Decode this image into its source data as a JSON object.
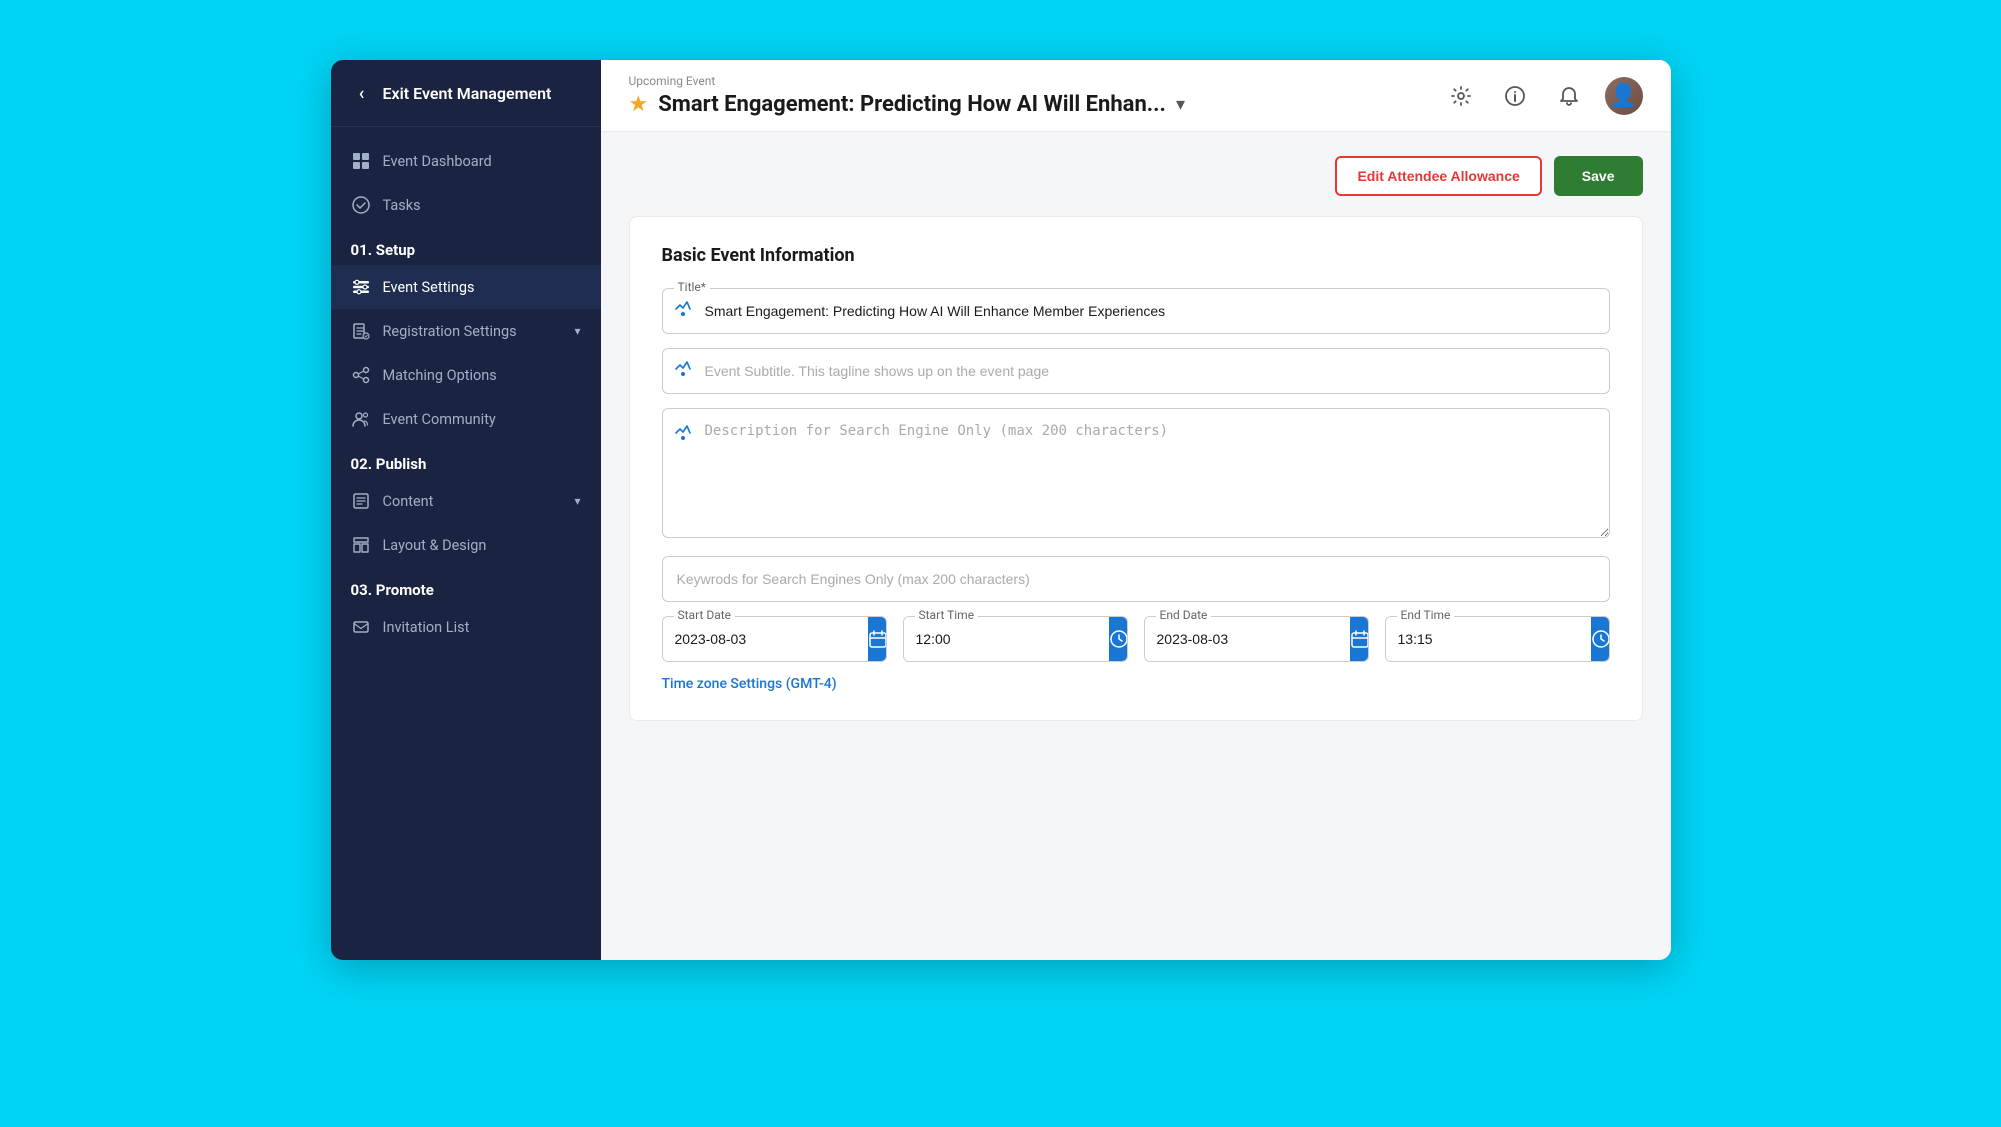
{
  "app": {
    "bg_color": "#00d4f5"
  },
  "sidebar": {
    "exit_label": "Exit Event Management",
    "back_arrow": "‹",
    "sections": [
      {
        "type": "item",
        "icon": "grid",
        "label": "Event Dashboard",
        "active": false,
        "name": "event-dashboard"
      },
      {
        "type": "item",
        "icon": "check-circle",
        "label": "Tasks",
        "active": false,
        "name": "tasks"
      },
      {
        "type": "header",
        "label": "01. Setup"
      },
      {
        "type": "item",
        "icon": "settings",
        "label": "Event Settings",
        "active": true,
        "name": "event-settings"
      },
      {
        "type": "item",
        "icon": "register",
        "label": "Registration Settings",
        "active": false,
        "name": "registration-settings",
        "has_chevron": true
      },
      {
        "type": "item",
        "icon": "share",
        "label": "Matching Options",
        "active": false,
        "name": "matching-options"
      },
      {
        "type": "item",
        "icon": "people",
        "label": "Event Community",
        "active": false,
        "name": "event-community"
      },
      {
        "type": "header",
        "label": "02. Publish"
      },
      {
        "type": "item",
        "icon": "content",
        "label": "Content",
        "active": false,
        "name": "content",
        "has_chevron": true
      },
      {
        "type": "item",
        "icon": "layout",
        "label": "Layout & Design",
        "active": false,
        "name": "layout-design"
      },
      {
        "type": "header",
        "label": "03. Promote"
      },
      {
        "type": "item",
        "icon": "invite",
        "label": "Invitation List",
        "active": false,
        "name": "invitation-list"
      }
    ]
  },
  "header": {
    "upcoming_label": "Upcoming Event",
    "event_title": "Smart Engagement: Predicting How AI Will Enhan...",
    "dropdown_char": "▾",
    "star": "★"
  },
  "toolbar": {
    "edit_allowance_label": "Edit Attendee Allowance",
    "save_label": "Save"
  },
  "form": {
    "section_title": "Basic Event Information",
    "title_label": "Title*",
    "title_value": "Smart Engagement: Predicting How AI Will Enhance Member Experiences",
    "subtitle_placeholder": "Event Subtitle. This tagline shows up on the event page",
    "description_placeholder": "Description for Search Engine Only (max 200 characters)",
    "keywords_placeholder": "Keywrods for Search Engines Only (max 200 characters)",
    "start_date_label": "Start Date",
    "start_date_value": "2023-08-03",
    "start_time_label": "Start Time",
    "start_time_value": "12:00",
    "end_date_label": "End Date",
    "end_date_value": "2023-08-03",
    "end_time_label": "End Time",
    "end_time_value": "13:15",
    "timezone_label": "Time zone Settings (GMT-4)"
  }
}
